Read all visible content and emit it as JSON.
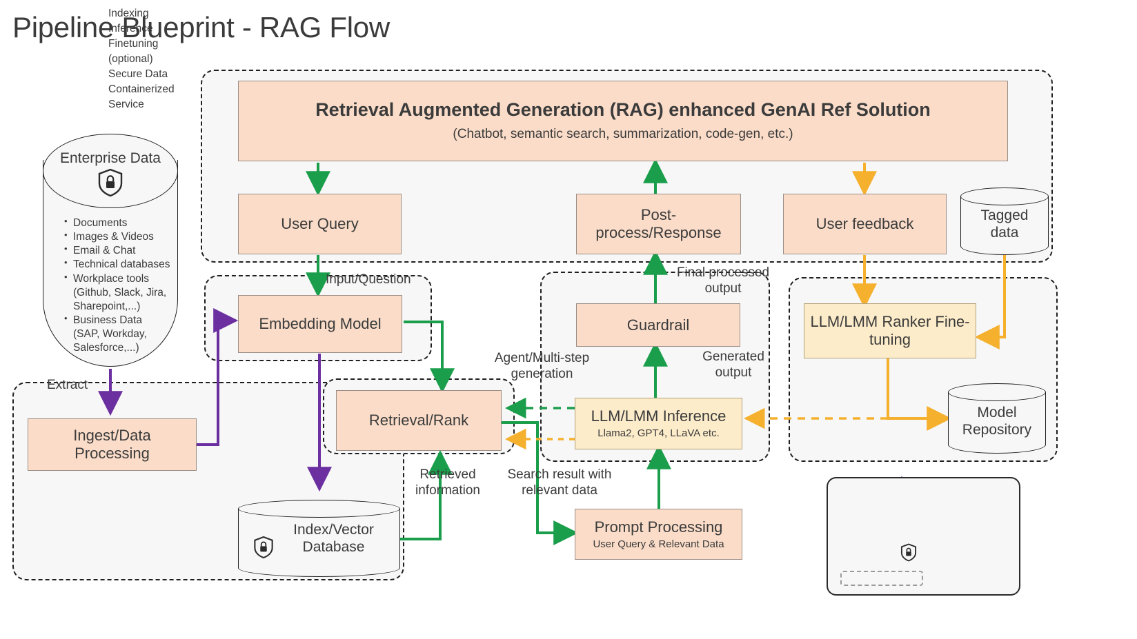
{
  "title": "Pipeline Blueprint - RAG Flow",
  "colors": {
    "indexing": "#6b2fa0",
    "inference": "#1a9e4b",
    "finetuning": "#f5b02e",
    "box_fill": "#fadcc8",
    "box_fill_yellow": "#fcecca",
    "group_fill": "#f7f7f7",
    "stroke": "#1f1f1f"
  },
  "enterprise_data": {
    "label": "Enterprise Data",
    "icon": "secure-shield-lock-icon",
    "items": [
      "Documents",
      "Images & Videos",
      "Email & Chat",
      "Technical databases",
      "Workplace tools (Github, Slack, Jira, Sharepoint,...)",
      "Business Data (SAP, Workday, Salesforce,...)"
    ]
  },
  "nodes": {
    "rag_solution": {
      "title": "Retrieval Augmented Generation (RAG) enhanced GenAI Ref Solution",
      "subtitle": "(Chatbot, semantic search, summarization, code-gen, etc.)"
    },
    "user_query": {
      "title": "User Query"
    },
    "post_process": {
      "title": "Post-process/Response"
    },
    "user_feedback": {
      "title": "User feedback"
    },
    "tagged_data": {
      "title": "Tagged data"
    },
    "embedding_model": {
      "title": "Embedding Model"
    },
    "guardrail": {
      "title": "Guardrail"
    },
    "ranker_finetuning": {
      "title": "LLM/LMM Ranker Fine-tuning"
    },
    "ingest": {
      "title": "Ingest/Data Processing"
    },
    "retrieval_rank": {
      "title": "Retrieval/Rank"
    },
    "llm_inference": {
      "title": "LLM/LMM Inference",
      "subtitle": "Llama2, GPT4, LLaVA etc."
    },
    "model_repository": {
      "title": "Model Repository"
    },
    "index_vector_db": {
      "title": "Index/Vector Database",
      "icon": "secure-shield-lock-icon"
    },
    "prompt_processing": {
      "title": "Prompt Processing",
      "subtitle": "User Query & Relevant Data"
    }
  },
  "edge_labels": {
    "extract": "Extract",
    "input_question": "Input/Question",
    "final_processed_output": "Final processed\noutput",
    "agent_multistep": "Agent/Multi-step\ngeneration",
    "generated_output": "Generated\noutput",
    "retrieved_information": "Retrieved\ninformation",
    "search_result": "Search result with\nrelevant data"
  },
  "legend": {
    "rows": [
      "Indexing",
      "Inference",
      "Finetuning",
      "(optional)",
      "Secure Data",
      "Containerized",
      "Service"
    ]
  }
}
